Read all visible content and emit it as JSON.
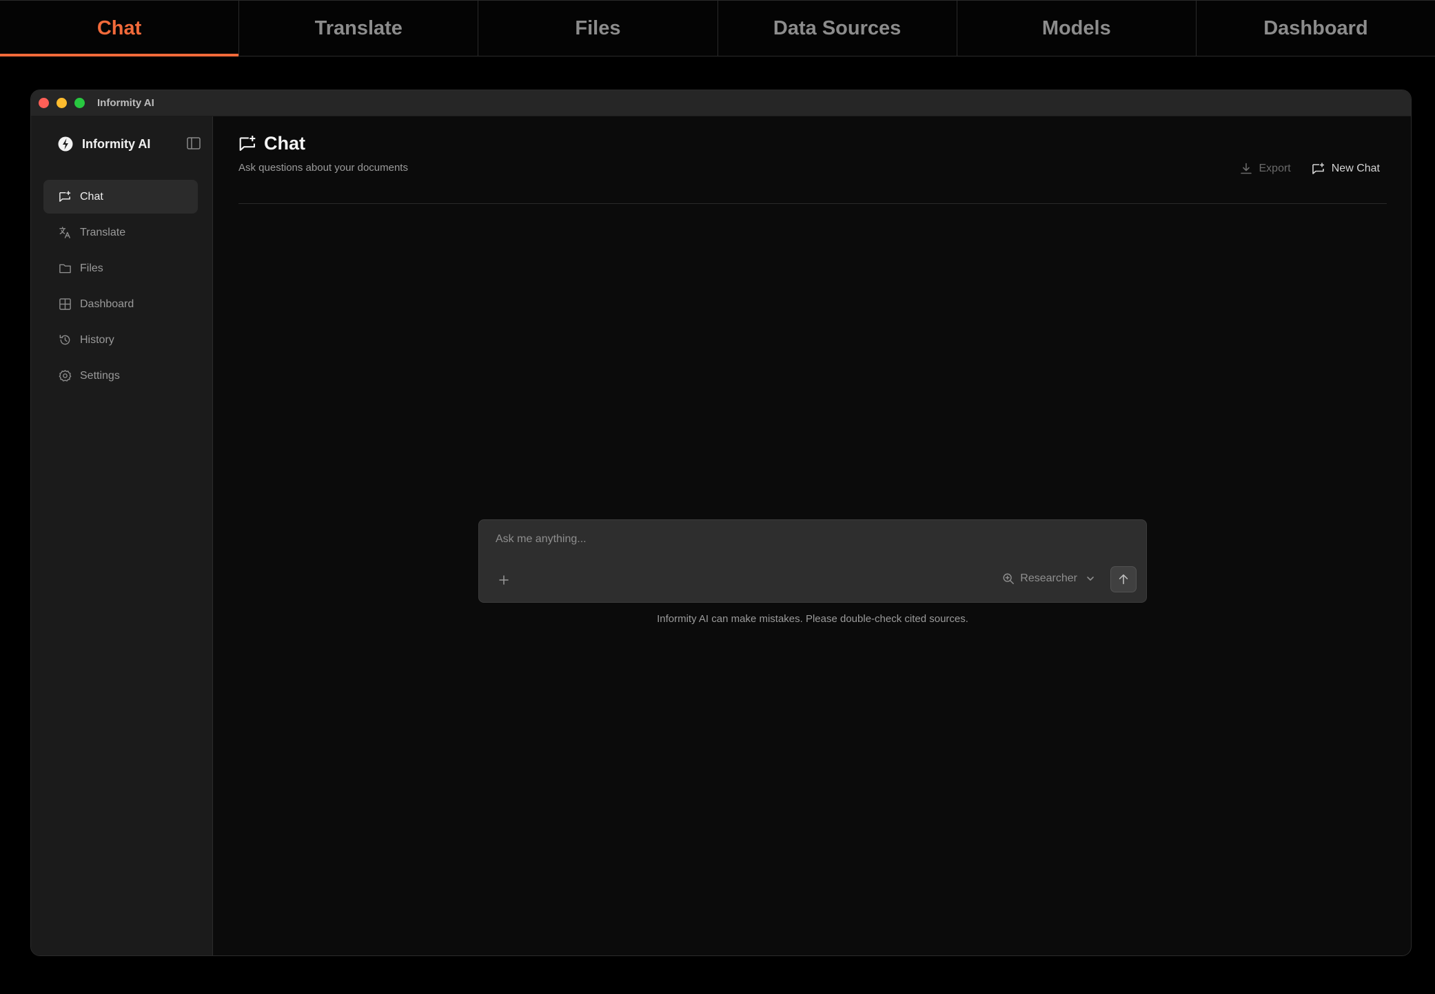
{
  "top_tabs": [
    {
      "label": "Chat",
      "active": true
    },
    {
      "label": "Translate"
    },
    {
      "label": "Files"
    },
    {
      "label": "Data Sources"
    },
    {
      "label": "Models"
    },
    {
      "label": "Dashboard"
    }
  ],
  "window": {
    "title": "Informity AI"
  },
  "sidebar": {
    "brand": "Informity AI",
    "items": [
      {
        "label": "Chat",
        "icon": "chat-plus-icon",
        "active": true
      },
      {
        "label": "Translate",
        "icon": "translate-icon"
      },
      {
        "label": "Files",
        "icon": "folder-icon"
      },
      {
        "label": "Dashboard",
        "icon": "grid-icon"
      },
      {
        "label": "History",
        "icon": "history-icon"
      },
      {
        "label": "Settings",
        "icon": "gear-icon"
      }
    ]
  },
  "header": {
    "title": "Chat",
    "subtitle": "Ask questions about your documents",
    "export_label": "Export",
    "new_chat_label": "New Chat"
  },
  "composer": {
    "placeholder": "Ask me anything...",
    "mode": "Researcher",
    "disclaimer": "Informity AI can make mistakes. Please double-check cited sources."
  },
  "colors": {
    "accent": "#f26a3a",
    "background": "#0b0b0b",
    "sidebar": "#1b1b1b"
  }
}
